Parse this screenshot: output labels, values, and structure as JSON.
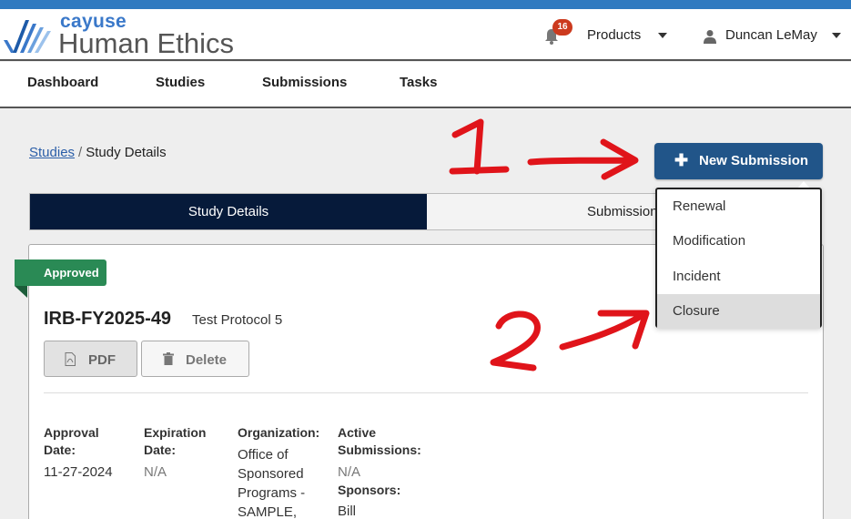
{
  "header": {
    "brand_small": "cayuse",
    "brand_big": "Human Ethics",
    "notification_count": "16",
    "products_label": "Products",
    "user_name": "Duncan LeMay"
  },
  "nav": {
    "items": [
      "Dashboard",
      "Studies",
      "Submissions",
      "Tasks"
    ]
  },
  "breadcrumb": {
    "link": "Studies",
    "separator": "/",
    "current": "Study Details"
  },
  "actions": {
    "new_submission_label": "New Submission"
  },
  "dropdown": {
    "items": [
      "Renewal",
      "Modification",
      "Incident",
      "Closure"
    ],
    "highlighted": "Closure"
  },
  "tabs": {
    "active": "Study Details",
    "other": "Submissions"
  },
  "study": {
    "status": "Approved",
    "id": "IRB-FY2025-49",
    "title": "Test Protocol 5",
    "pdf_label": "PDF",
    "delete_label": "Delete",
    "fields": {
      "approval_date_label_1": "Approval",
      "approval_date_label_2": "Date:",
      "approval_date": "11-27-2024",
      "expiration_date_label_1": "Expiration",
      "expiration_date_label_2": "Date:",
      "expiration_date": "N/A",
      "organization_label": "Organization:",
      "organization_lines": [
        "Office of",
        "Sponsored",
        "Programs -",
        "SAMPLE,"
      ],
      "active_submissions_label_1": "Active",
      "active_submissions_label_2": "Submissions:",
      "active_submissions": "N/A",
      "sponsors_label": "Sponsors:",
      "sponsors": "Bill"
    }
  },
  "annotations": {
    "step1": "1",
    "step2": "2"
  },
  "colors": {
    "topbar": "#2f7ac0",
    "primary_button": "#215589",
    "active_tab": "#061a3a",
    "approved_badge": "#2a8a55",
    "notification_badge": "#cc3a1e",
    "annotation": "#e0141a"
  }
}
